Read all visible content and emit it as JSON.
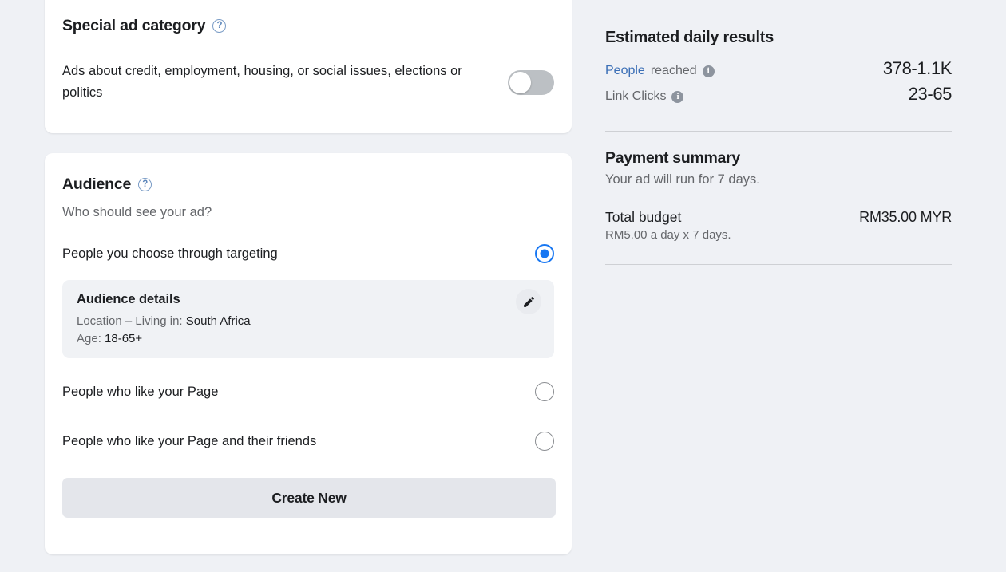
{
  "special_ad": {
    "title": "Special ad category",
    "help_icon": "question-mark-icon",
    "description": "Ads about credit, employment, housing, or social issues, elections or politics",
    "toggle_state": "off"
  },
  "audience": {
    "title": "Audience",
    "help_icon": "question-mark-icon",
    "question": "Who should see your ad?",
    "options": [
      {
        "label": "People you choose through targeting",
        "selected": true
      },
      {
        "label": "People who like your Page",
        "selected": false
      },
      {
        "label": "People who like your Page and their friends",
        "selected": false
      }
    ],
    "details": {
      "title": "Audience details",
      "location_label": "Location – Living in:",
      "location_value": "South Africa",
      "age_label": "Age:",
      "age_value": "18-65+",
      "edit_icon": "pencil-icon"
    },
    "create_button": "Create New"
  },
  "estimated": {
    "title": "Estimated daily results",
    "rows": [
      {
        "link_text": "People",
        "rest_text": " reached",
        "info_icon": "info-icon",
        "value": "378-1.1K"
      },
      {
        "link_text": "",
        "rest_text": "Link Clicks",
        "info_icon": "info-icon",
        "value": "23-65"
      }
    ]
  },
  "payment": {
    "title": "Payment summary",
    "subtitle": "Your ad will run for 7 days.",
    "budget_label": "Total budget",
    "budget_value": "RM35.00 MYR",
    "budget_note": "RM5.00 a day x 7 days."
  },
  "colors": {
    "accent_blue": "#1877f2",
    "link_blue": "#3b6fb6",
    "page_bg": "#eff1f5",
    "card_bg": "#ffffff",
    "muted_text": "#65676b"
  }
}
